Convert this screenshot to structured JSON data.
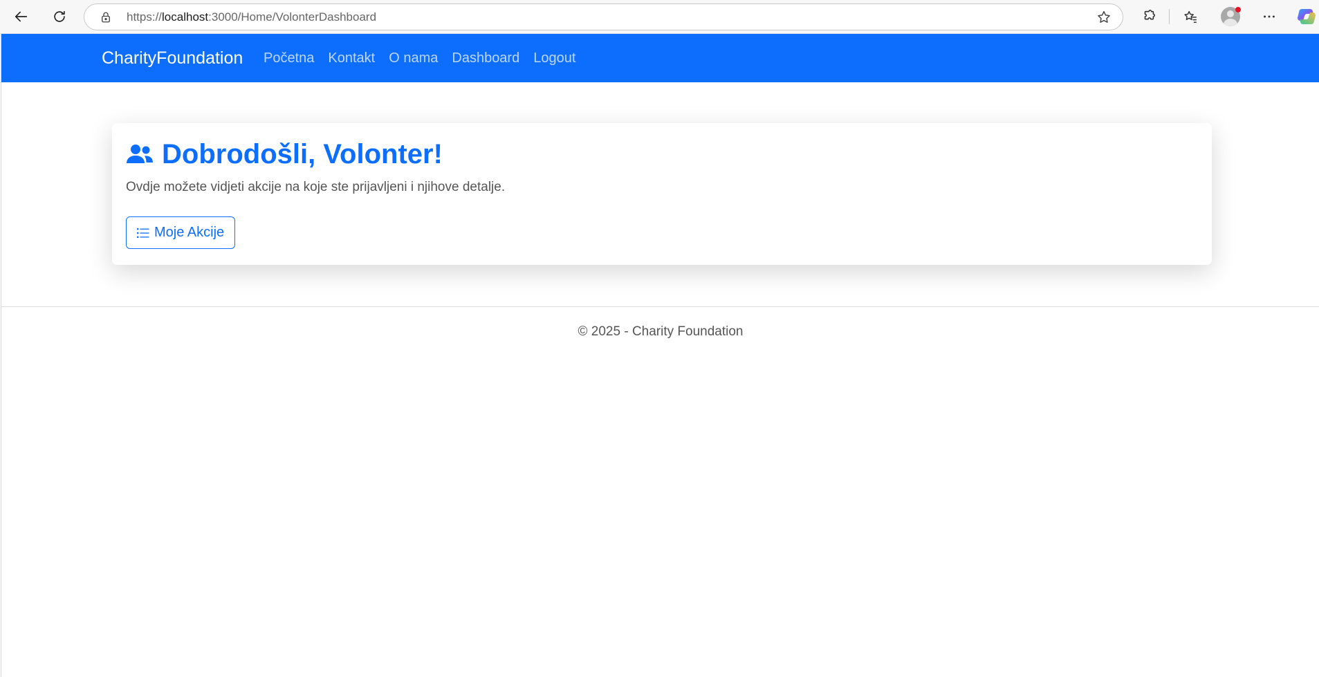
{
  "browser": {
    "url_scheme": "https://",
    "url_host": "localhost",
    "url_path": ":3000/Home/VolonterDashboard"
  },
  "navbar": {
    "brand": "CharityFoundation",
    "links": [
      "Početna",
      "Kontakt",
      "O nama",
      "Dashboard",
      "Logout"
    ],
    "bg_color": "#0d6efd"
  },
  "welcome_card": {
    "title": "Dobrodošli, Volonter!",
    "title_icon": "users-icon",
    "text": "Ovdje možete vidjeti akcije na koje ste prijavljeni i njihove detalje.",
    "button_label": "Moje Akcije",
    "button_icon": "list-icon"
  },
  "footer": {
    "text": "© 2025 - Charity Foundation"
  }
}
